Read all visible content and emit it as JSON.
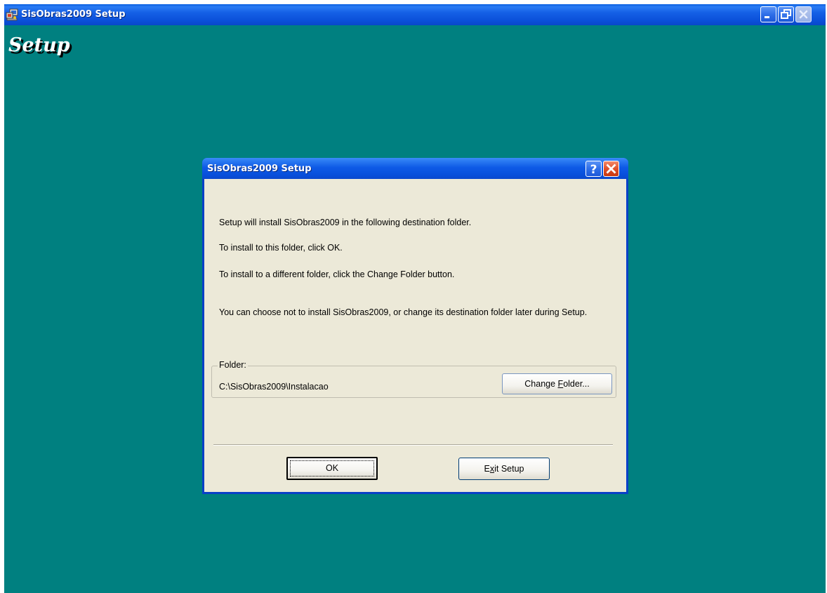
{
  "window": {
    "title": "SisObras2009 Setup",
    "banner": "Setup",
    "background_color": "#008080"
  },
  "dialog": {
    "title": "SisObras2009 Setup",
    "messages": [
      "Setup will install SisObras2009 in the following destination folder.",
      "To install to this folder, click OK.",
      "To install to a different folder, click the Change Folder button.",
      "You can choose not to install SisObras2009, or change its destination folder later during Setup."
    ],
    "folder": {
      "legend": "Folder:",
      "path": "C:\\SisObras2009\\Instalacao",
      "change_button": {
        "pre": "Change ",
        "accel": "F",
        "post": "older..."
      }
    },
    "ok_label": "OK",
    "exit_button": {
      "pre": "E",
      "accel": "x",
      "post": "it Setup"
    }
  },
  "icons": {
    "app": "setup-computer-icon",
    "minimize": "minimize-icon",
    "restore": "restore-icon",
    "close": "close-icon",
    "help": "help-icon"
  }
}
